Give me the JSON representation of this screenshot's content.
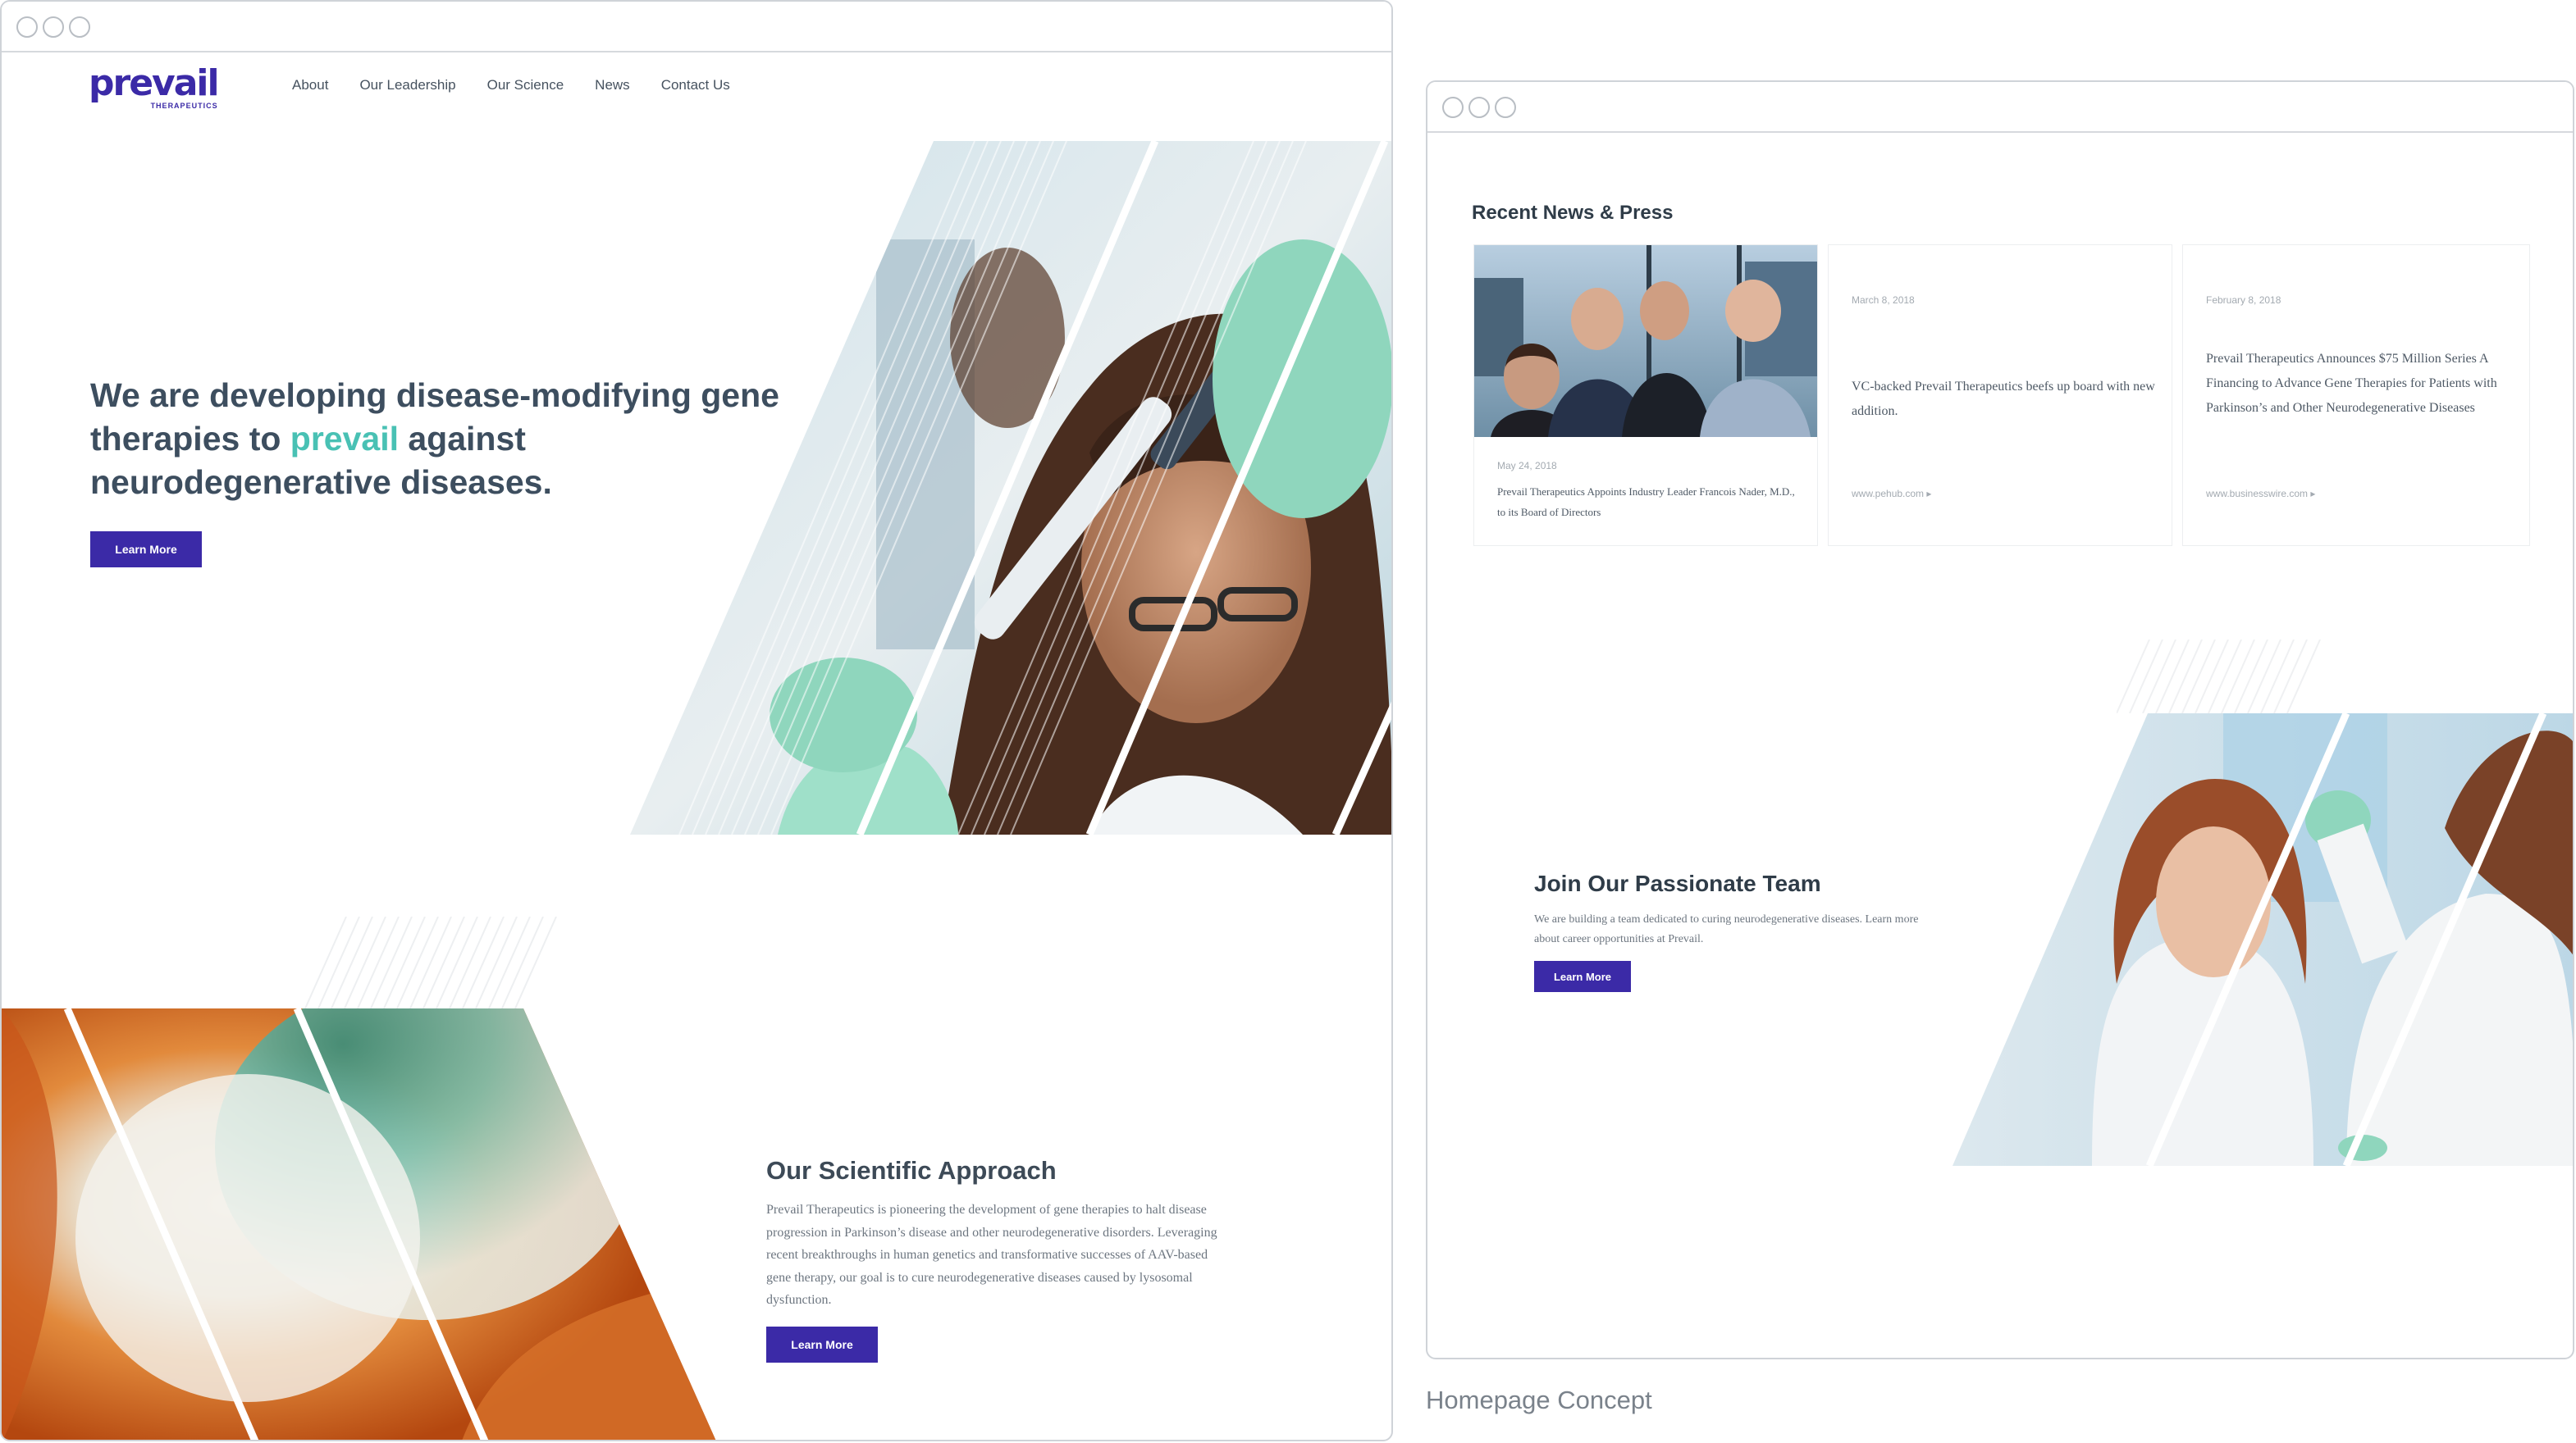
{
  "left_window": {
    "logo": {
      "main": "prevail",
      "sub": "THERAPEUTICS"
    },
    "nav": [
      {
        "label": "About"
      },
      {
        "label": "Our Leadership"
      },
      {
        "label": "Our Science"
      },
      {
        "label": "News"
      },
      {
        "label": "Contact Us"
      }
    ],
    "hero": {
      "title_part1": "We are developing disease-modifying gene therapies to ",
      "title_accent": "prevail",
      "title_part2": " against neurodegenerative diseases.",
      "button": "Learn More"
    },
    "science": {
      "title": "Our Scientific Approach",
      "body": "Prevail Therapeutics is pioneering the development of gene therapies to halt disease progression in Parkinson’s disease and other neurodegenerative disorders. Leveraging recent breakthroughs in human genetics and transformative successes of AAV-based gene therapy, our goal is to cure neurodegenerative diseases caused by lysosomal dysfunction.",
      "button": "Learn More"
    }
  },
  "right_window": {
    "news_title": "Recent News & Press",
    "cards": [
      {
        "date": "May 24, 2018",
        "text": "Prevail Therapeutics Appoints Industry Leader Francois Nader, M.D., to its Board of Directors",
        "source": ""
      },
      {
        "date": "March 8, 2018",
        "text": "VC-backed Prevail Therapeutics beefs up board with new addition.",
        "source": "www.pehub.com ▸"
      },
      {
        "date": "February 8, 2018",
        "text": "Prevail Therapeutics Announces $75 Million Series A Financing to Advance Gene Therapies for Patients with Parkinson’s and Other Neurodegenerative Diseases",
        "source": "www.businesswire.com ▸"
      }
    ],
    "join": {
      "title": "Join Our Passionate Team",
      "body": "We are building a team dedicated to curing neurodegenerative diseases. Learn more about career opportunities at Prevail.",
      "button": "Learn More"
    }
  },
  "caption": "Homepage Concept",
  "colors": {
    "brand": "#3b2aa7",
    "accent": "#49c1b4",
    "heading": "#3d4e5f"
  }
}
